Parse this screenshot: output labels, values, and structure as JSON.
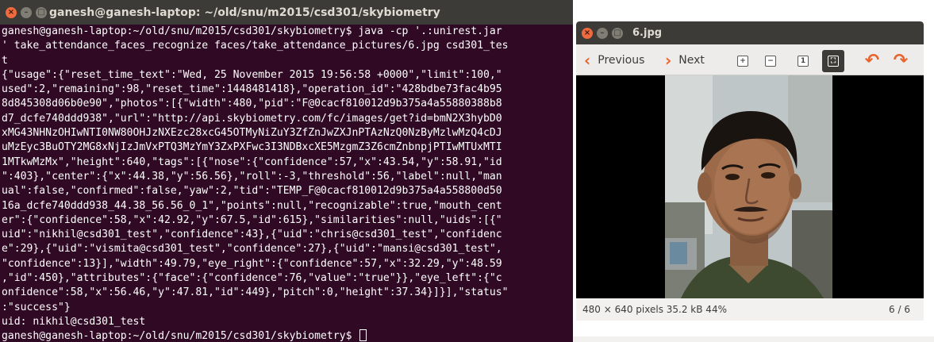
{
  "terminal": {
    "title": "ganesh@ganesh-laptop: ~/old/snu/m2015/csd301/skybiometry",
    "lines": [
      "ganesh@ganesh-laptop:~/old/snu/m2015/csd301/skybiometry$ java -cp '.:unirest.jar",
      "' take_attendance_faces_recognize faces/take_attendance_pictures/6.jpg csd301_tes",
      "t",
      "{\"usage\":{\"reset_time_text\":\"Wed, 25 November 2015 19:56:58 +0000\",\"limit\":100,\"",
      "used\":2,\"remaining\":98,\"reset_time\":1448481418},\"operation_id\":\"428bdbe73fac4b95",
      "8d845308d06b0e90\",\"photos\":[{\"width\":480,\"pid\":\"F@0cacf810012d9b375a4a55880388b8",
      "d7_dcfe740ddd938\",\"url\":\"http://api.skybiometry.com/fc/images/get?id=bmN2X3hybD0",
      "xMG43NHNzOHIwNTI0NW80OHJzNXEzc28xcG45OTMyNiZuY3ZfZnJwZXJnPTAzNzQ0NzByMzlwMzQ4cDJ",
      "uMzEyc3BuOTY2MG8xNjIzJmVxPTQ3MzYmY3ZxPXFwc3I3NDBxcXE5MzgmZ3Z6cmZnbnpjPTIwMTUxMTI",
      "1MTkwMzMx\",\"height\":640,\"tags\":[{\"nose\":{\"confidence\":57,\"x\":43.54,\"y\":58.91,\"id",
      "\":403},\"center\":{\"x\":44.38,\"y\":56.56},\"roll\":-3,\"threshold\":56,\"label\":null,\"man",
      "ual\":false,\"confirmed\":false,\"yaw\":2,\"tid\":\"TEMP_F@0cacf810012d9b375a4a558800d50",
      "16a_dcfe740ddd938_44.38_56.56_0_1\",\"points\":null,\"recognizable\":true,\"mouth_cent",
      "er\":{\"confidence\":58,\"x\":42.92,\"y\":67.5,\"id\":615},\"similarities\":null,\"uids\":[{\"",
      "uid\":\"nikhil@csd301_test\",\"confidence\":43},{\"uid\":\"chris@csd301_test\",\"confidenc",
      "e\":29},{\"uid\":\"vismita@csd301_test\",\"confidence\":27},{\"uid\":\"mansi@csd301_test\",",
      "\"confidence\":13}],\"width\":49.79,\"eye_right\":{\"confidence\":57,\"x\":32.29,\"y\":48.59",
      ",\"id\":450},\"attributes\":{\"face\":{\"confidence\":76,\"value\":\"true\"}},\"eye_left\":{\"c",
      "onfidence\":58,\"x\":56.46,\"y\":47.81,\"id\":449},\"pitch\":0,\"height\":37.34}]}],\"status\"",
      ":\"success\"}",
      "uid: nikhil@csd301_test"
    ],
    "prompt": "ganesh@ganesh-laptop:~/old/snu/m2015/csd301/skybiometry$ "
  },
  "viewer": {
    "title": "6.jpg",
    "previous_label": "Previous",
    "next_label": "Next",
    "status_info": "480 × 640 pixels  35.2 kB   44%",
    "status_count": "6 / 6"
  },
  "colors": {
    "terminal_bg": "#300a24",
    "titlebar": "#3c3b37",
    "accent": "#e8642c",
    "close_button": "#ef6a3e"
  },
  "icons": [
    "close-icon",
    "minimize-icon",
    "maximize-icon",
    "chevron-left-icon",
    "chevron-right-icon",
    "zoom-in-icon",
    "zoom-out-icon",
    "zoom-normal-icon",
    "best-fit-icon",
    "rotate-left-icon",
    "rotate-right-icon"
  ]
}
